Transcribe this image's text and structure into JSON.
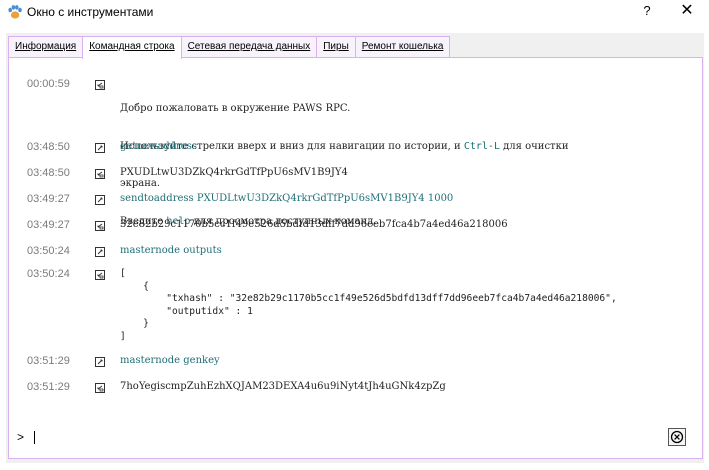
{
  "window": {
    "title": "Окно с инструментами",
    "help_label": "?",
    "close_label": "✕"
  },
  "tabs": [
    {
      "label": "Информация",
      "active": false
    },
    {
      "label": "Командная строка",
      "active": true
    },
    {
      "label": "Сетевая передача данных",
      "active": false
    },
    {
      "label": "Пиры",
      "active": false
    },
    {
      "label": "Ремонт кошелька",
      "active": false
    }
  ],
  "console": {
    "welcome": {
      "time": "00:00:59",
      "line1": "Добро пожаловать в окружение PAWS RPC.",
      "line2_pre": "Используйте стрелки вверх и вниз для навигации по истории, и ",
      "line2_key": "Ctrl-L",
      "line2_post": " для очистки",
      "line3": "экрана.",
      "line4_pre": "Введите ",
      "line4_key": "help",
      "line4_post": " для просмотра доступных команд."
    },
    "entries": [
      {
        "time": "03:48:50",
        "text": "getnewaddress",
        "kind": "request"
      },
      {
        "time": "03:48:50",
        "text": "PXUDLtwU3DZkQ4rkrGdTfPpU6sMV1B9JY4",
        "kind": "reply"
      },
      {
        "time": "03:49:27",
        "text": "sendtoaddress PXUDLtwU3DZkQ4rkrGdTfPpU6sMV1B9JY4 1000",
        "kind": "request"
      },
      {
        "time": "03:49:27",
        "text": "32e82b29c1170b5cc1f49e526d5bdfd13dff7dd96eeb7fca4b7a4ed46a218006",
        "kind": "reply"
      },
      {
        "time": "03:50:24",
        "text": "masternode outputs",
        "kind": "request"
      },
      {
        "time": "03:50:24",
        "text": "[\n    {\n        \"txhash\" : \"32e82b29c1170b5cc1f49e526d5bdfd13dff7dd96eeb7fca4b7a4ed46a218006\",\n        \"outputidx\" : 1\n    }\n]",
        "kind": "reply"
      },
      {
        "time": "03:51:29",
        "text": "masternode genkey",
        "kind": "request"
      },
      {
        "time": "03:51:29",
        "text": "7hoYegiscmpZuhEzhXQJAM23DEXA4u6u9iNyt4tJh4uGNk4zpZg",
        "kind": "reply"
      }
    ]
  },
  "input": {
    "prompt": ">",
    "value": ""
  },
  "colors": {
    "command_text": "#1f6f77",
    "timestamp": "#7b7b7b",
    "tab_border": "#d9b0f0"
  },
  "icons": {
    "app": "paw-icon",
    "request": "request-arrow-icon",
    "reply": "reply-arrow-icon",
    "clear": "clear-console-icon"
  }
}
